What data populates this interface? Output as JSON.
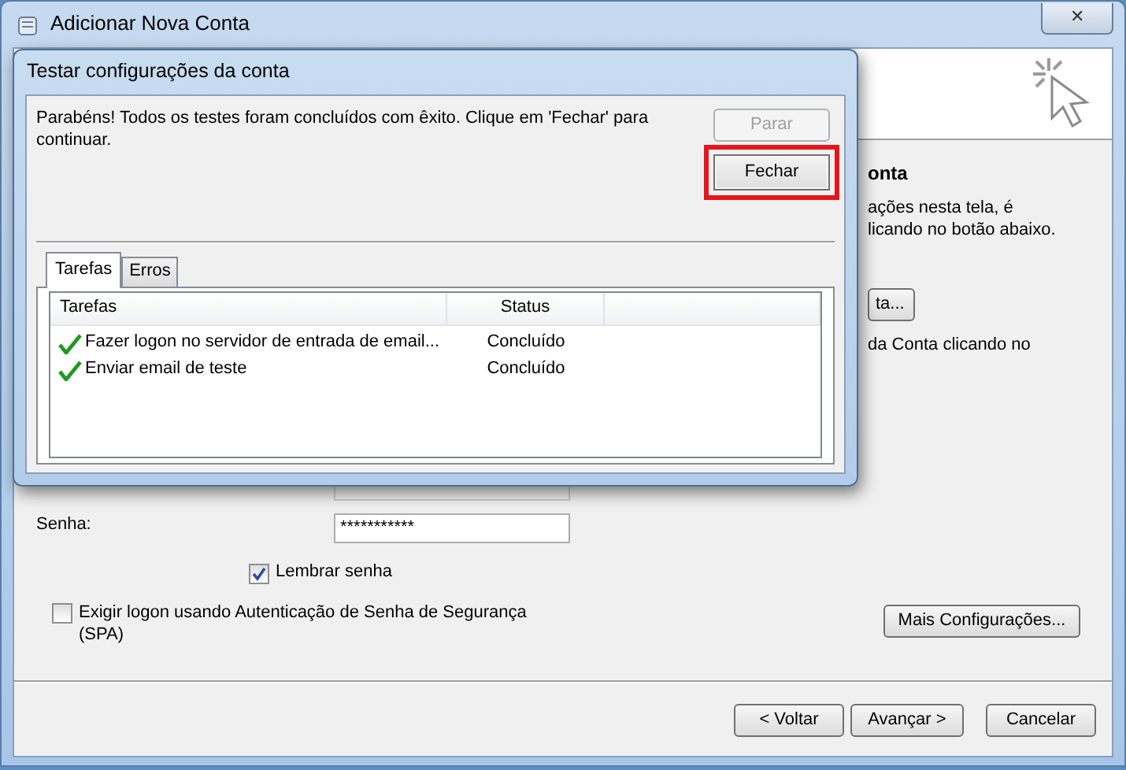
{
  "window": {
    "title": "Adicionar Nova Conta",
    "close": "✕"
  },
  "background_page": {
    "heading": "onta",
    "lines": [
      "ações nesta tela, é",
      "licando no botão abaixo."
    ],
    "side_button": "ta...",
    "line_after_button": "da Conta clicando no",
    "password_label": "Senha:",
    "password_value": "***********",
    "remember": {
      "label": "Lembrar senha",
      "checked": true
    },
    "spa": {
      "label": "Exigir logon usando Autenticação de Senha de Segurança (SPA)",
      "checked": false
    },
    "more_button": "Mais Configurações...",
    "nav_buttons": [
      "< Voltar",
      "Avançar >",
      "Cancelar"
    ]
  },
  "dialog": {
    "title": "Testar configurações da conta",
    "message": "Parabéns! Todos os testes foram concluídos com êxito. Clique em 'Fechar' para continuar.",
    "buttons": [
      {
        "label": "Parar",
        "disabled": true,
        "highlighted": false
      },
      {
        "label": "Fechar",
        "disabled": false,
        "highlighted": true
      }
    ],
    "tabs": [
      {
        "label": "Tarefas",
        "selected": true
      },
      {
        "label": "Erros",
        "selected": false
      }
    ],
    "table": {
      "columns": [
        "Tarefas",
        "Status"
      ],
      "rows": [
        {
          "task": "Fazer logon no servidor de entrada de email...",
          "status": "Concluído",
          "done": true
        },
        {
          "task": "Enviar email de teste",
          "status": "Concluído",
          "done": true
        }
      ]
    }
  }
}
